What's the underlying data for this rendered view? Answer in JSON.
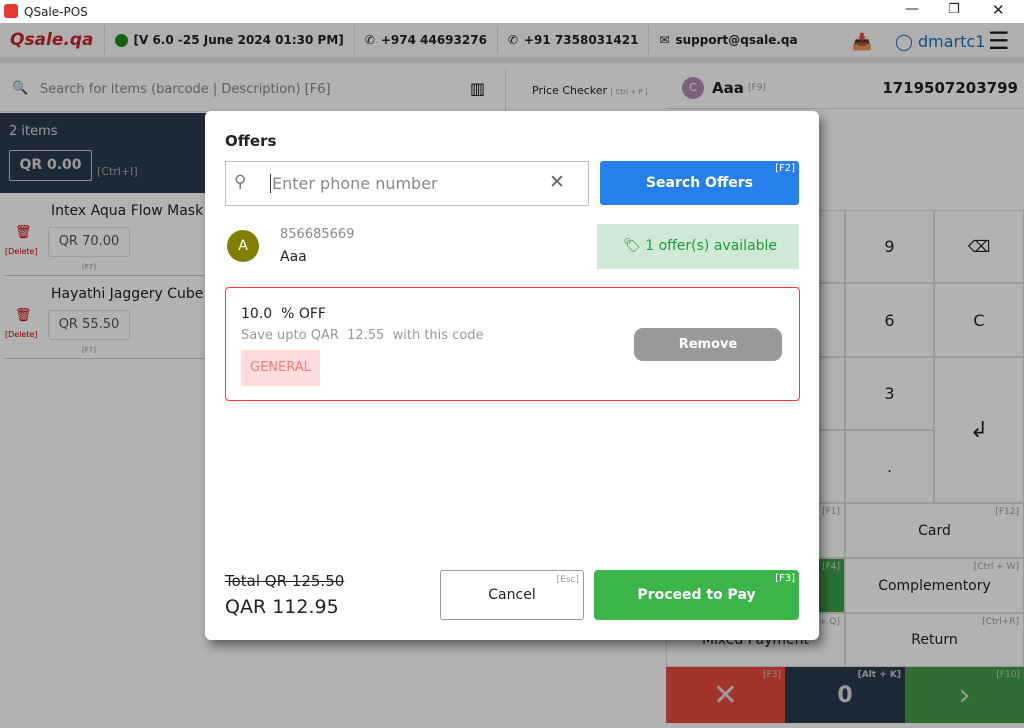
{
  "window": {
    "title": "QSale-POS"
  },
  "header": {
    "logo": "Qsale.qa",
    "version": "[V 6.0 -25 June 2024 01:30 PM]",
    "phone1": "+974 44693276",
    "phone2": "+91 7358031421",
    "email": "support@qsale.qa",
    "user": "dmartc1"
  },
  "search": {
    "placeholder": "Search for items (barcode | Description) [F6]",
    "price_checker": "Price Checker",
    "price_checker_shortcut": "[ Ctrl + P ]"
  },
  "customer": {
    "initial": "C",
    "name": "Aaa",
    "shortcut": "[F9]",
    "order_id": "1719507203799"
  },
  "cart": {
    "count": "2 items",
    "discount": "QR 0.00",
    "discount_shortcut": "[Ctrl+I]",
    "items": [
      {
        "name": "Intex Aqua Flow Mask",
        "price": "QR 70.00",
        "delete": "[Delete]",
        "shortcut": "[F7]"
      },
      {
        "name": "Hayathi Jaggery Cube",
        "price": "QR 55.50",
        "delete": "[Delete]",
        "shortcut": "[F7]"
      }
    ]
  },
  "keypad": {
    "keys": [
      "9",
      "6",
      "3",
      "."
    ],
    "card": "Card",
    "card_sc": "[F12]",
    "comp": "Complementory",
    "comp_sc": "[Ctrl + W]",
    "ret": "Return",
    "ret_sc": "[Ctrl+R]",
    "mixed": "Mixed Payment",
    "mixed_sc": "[Ctrl + Q]",
    "f1": "[F1]",
    "f4": "[F4]"
  },
  "bottom": {
    "cancel_sc": "[F3]",
    "zero": "0",
    "zero_sc": "[Alt + K]",
    "next_sc": "[F10]"
  },
  "modal": {
    "title": "Offers",
    "phone_placeholder": "Enter phone number",
    "search_btn": "Search Offers",
    "search_sc": "[F2]",
    "customer_initial": "A",
    "customer_phone": "856685669",
    "customer_name": "Aaa",
    "offers_available": "1 offer(s) available",
    "offer": {
      "title": "10.0  % OFF",
      "desc": "Save upto QAR  12.55  with this code",
      "code": "GENERAL",
      "remove": "Remove"
    },
    "total_old": "Total QR 125.50",
    "total_new": "QAR 112.95",
    "cancel": "Cancel",
    "cancel_sc": "[Esc]",
    "pay": "Proceed to Pay",
    "pay_sc": "[F3]"
  },
  "colors": {
    "blue": "#2680eb",
    "green": "#3bb54a",
    "red": "#e53935",
    "olive": "#808000"
  }
}
